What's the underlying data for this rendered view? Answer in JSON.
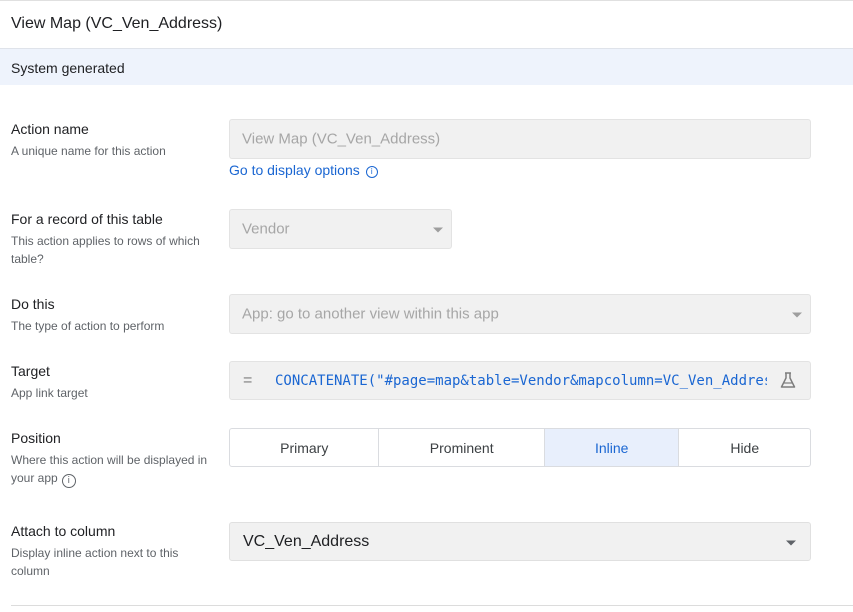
{
  "header": {
    "title": "View Map (VC_Ven_Address)"
  },
  "system_bar": {
    "text": "System generated"
  },
  "action_name": {
    "label": "Action name",
    "description": "A unique name for this action",
    "value": "View Map (VC_Ven_Address)",
    "link": "Go to display options"
  },
  "record_table": {
    "label": "For a record of this table",
    "description": "This action applies to rows of which table?",
    "value": "Vendor"
  },
  "do_this": {
    "label": "Do this",
    "description": "The type of action to perform",
    "value": "App: go to another view within this app"
  },
  "target": {
    "label": "Target",
    "description": "App link target",
    "prefix": "=",
    "expression": "CONCATENATE(\"#page=map&table=Vendor&mapcolumn=VC_Ven_Address"
  },
  "position": {
    "label": "Position",
    "description": "Where this action will be displayed in your app",
    "options": [
      "Primary",
      "Prominent",
      "Inline",
      "Hide"
    ],
    "selected": "Inline"
  },
  "attach": {
    "label": "Attach to column",
    "description": "Display inline action next to this column",
    "value": "VC_Ven_Address"
  },
  "colors": {
    "accent": "#1a66d2",
    "selected_bg": "#e8effc",
    "disabled_bg": "#f1f1f1",
    "system_bar_bg": "#eef3fc"
  },
  "icons": {
    "info": "info-icon",
    "flask": "flask-icon",
    "dropdown": "chevron-down-icon"
  }
}
